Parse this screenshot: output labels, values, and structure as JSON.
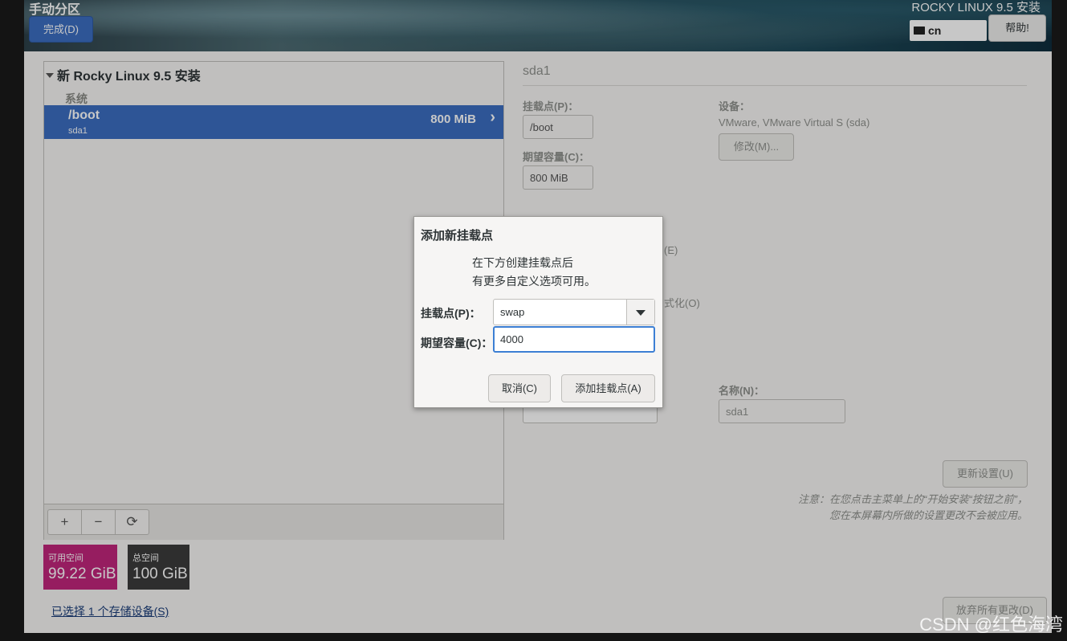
{
  "header": {
    "title": "手动分区",
    "done_label": "完成(D)",
    "product": "ROCKY LINUX 9.5 安装",
    "keyboard_layout": "cn",
    "help_label": "帮助!"
  },
  "tree": {
    "root_label": "新 Rocky Linux 9.5 安装",
    "section_label": "系统",
    "partitions": [
      {
        "mount": "/boot",
        "device": "sda1",
        "size": "800 MiB",
        "selected": true
      }
    ]
  },
  "toolbar": {
    "add_symbol": "+",
    "remove_symbol": "−",
    "refresh_symbol": "⟳"
  },
  "space": {
    "available_label": "可用空间",
    "available_value": "99.22 GiB",
    "available_color": "#c0267b",
    "total_label": "总空间",
    "total_value": "100 GiB",
    "total_color": "#3c3c3c"
  },
  "selected_devices_link": "已选择 1 个存储设备(S)",
  "details": {
    "title": "sda1",
    "mount_label": "挂载点(P)：",
    "mount_value": "/boot",
    "capacity_label": "期望容量(C)：",
    "capacity_value": "800 MiB",
    "device_label": "设备：",
    "device_value": "VMware, VMware Virtual S (sda)",
    "modify_label": "修改(M)...",
    "encrypt_fragment": "(E)",
    "reformat_fragment": "式化(O)",
    "name_label": "名称(N)：",
    "name_value": "sda1",
    "update_label": "更新设置(U)",
    "note": "注意：在您点击主菜单上的“开始安装“按钮之前”，您在本屏幕内所做的设置更改不会被应用。",
    "discard_label": "放弃所有更改(D)"
  },
  "dialog": {
    "title": "添加新挂载点",
    "message_line1": "在下方创建挂载点后",
    "message_line2": "有更多自定义选项可用。",
    "mount_label": "挂载点(P)：",
    "mount_value": "swap",
    "capacity_label": "期望容量(C)：",
    "capacity_value": "4000",
    "cancel_label": "取消(C)",
    "add_label": "添加挂载点(A)"
  },
  "watermark": "CSDN @红色海湾"
}
